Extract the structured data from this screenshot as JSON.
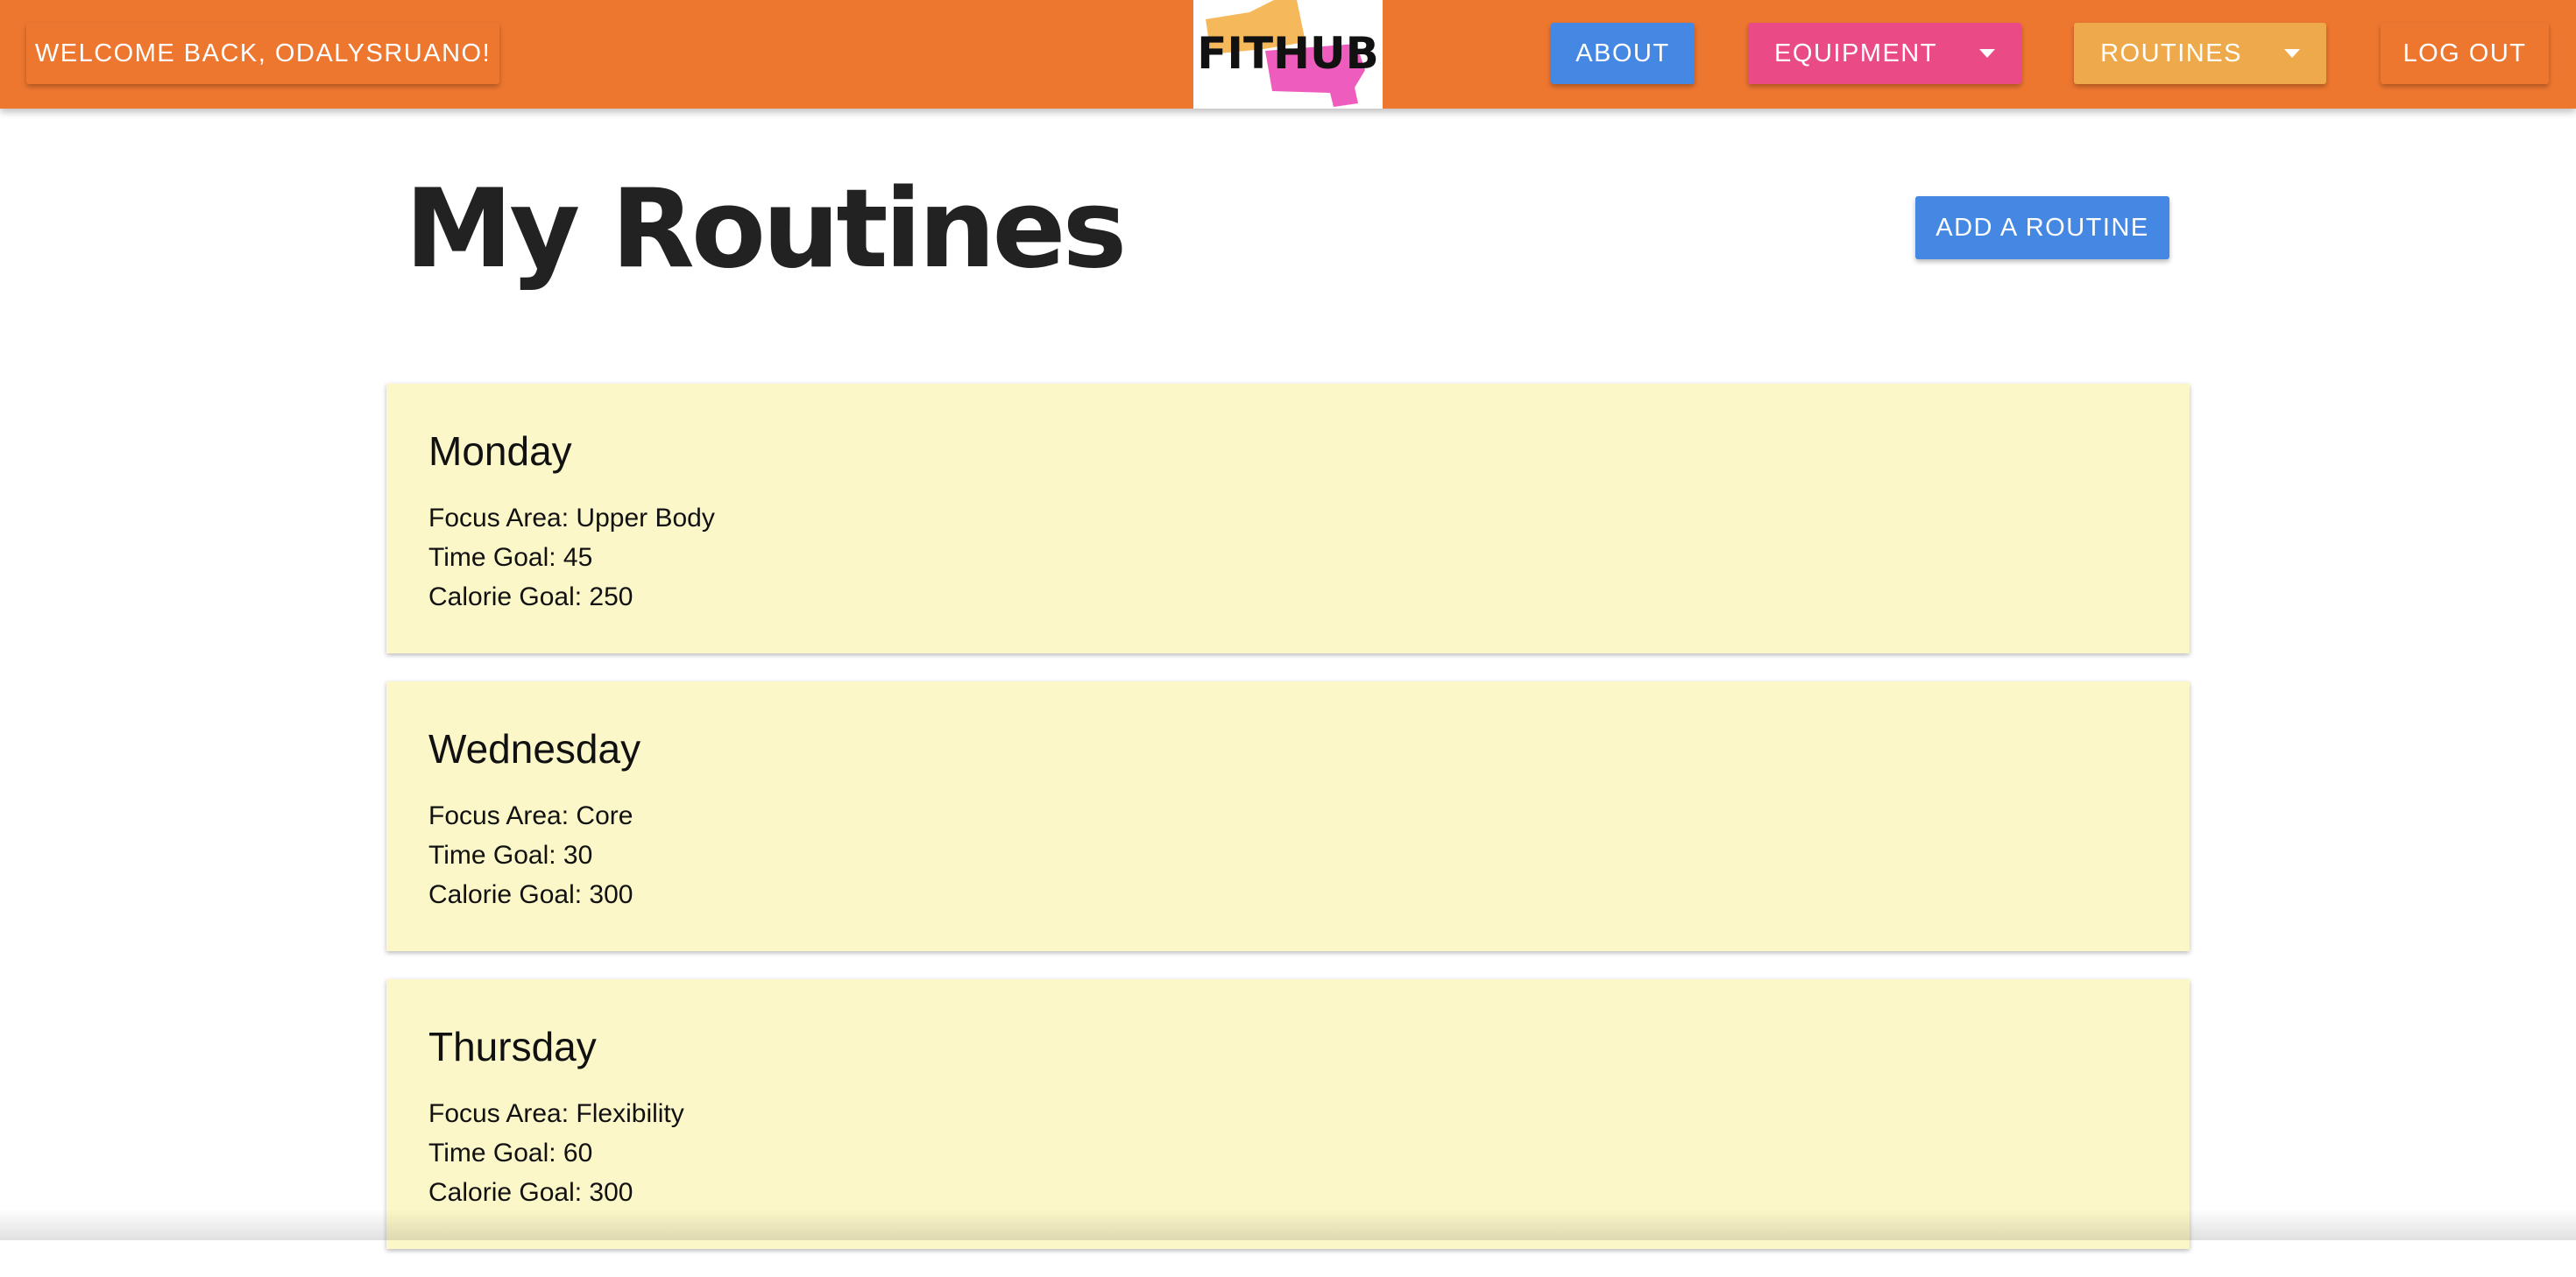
{
  "navbar": {
    "welcome_label": "WELCOME BACK, ODALYSRUANO!",
    "logo_text": "FITHUB",
    "about_label": "ABOUT",
    "equipment_label": "EQUIPMENT",
    "routines_label": "ROUTINES",
    "logout_label": "LOG OUT"
  },
  "main": {
    "title": "My Routines",
    "add_routine_label": "ADD A ROUTINE",
    "routines": [
      {
        "day": "Monday",
        "focus": "Focus Area: Upper Body",
        "time": "Time Goal: 45",
        "calories": "Calorie Goal: 250"
      },
      {
        "day": "Wednesday",
        "focus": "Focus Area: Core",
        "time": "Time Goal: 30",
        "calories": "Calorie Goal: 300"
      },
      {
        "day": "Thursday",
        "focus": "Focus Area: Flexibility",
        "time": "Time Goal: 60",
        "calories": "Calorie Goal: 300"
      }
    ]
  },
  "colors": {
    "navbar": "#ee7730",
    "about": "#4488e4",
    "equipment": "#ea4b86",
    "routines": "#eea94a",
    "card": "#fcf7c8",
    "logo_yellow": "#f5b85a",
    "logo_pink": "#ee5dbd"
  },
  "icons": {
    "equipment_caret": "chevron-down-icon",
    "routines_caret": "chevron-down-icon"
  }
}
